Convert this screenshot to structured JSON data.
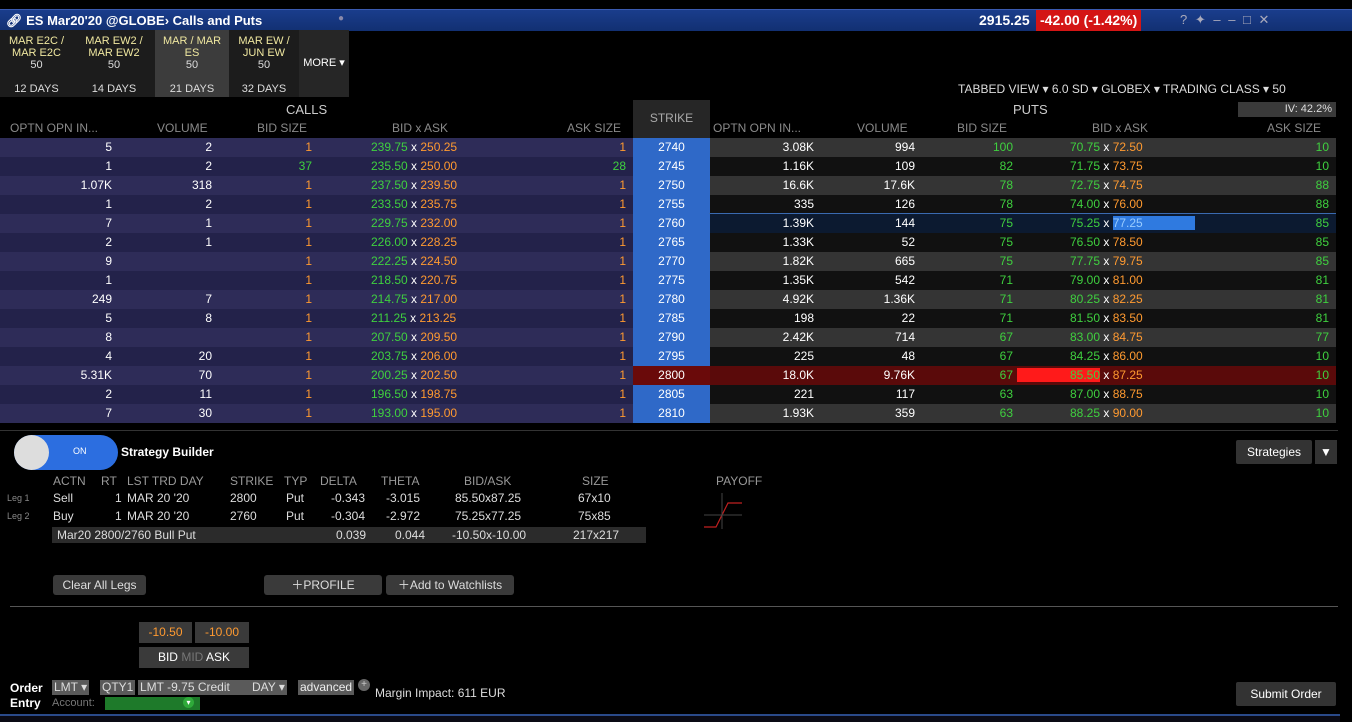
{
  "window": {
    "title": "ES Mar20'20 @GLOBE› Calls and Puts",
    "price": "2915.25",
    "change": "-42.00 (-1.42%)",
    "controls": "? ✦ ‒ – □ ✕"
  },
  "tabs": [
    {
      "l1": "MAR E2C /",
      "l2": "MAR E2C",
      "l3": "50",
      "days": "12 DAYS"
    },
    {
      "l1": "MAR EW2 /",
      "l2": "MAR EW2",
      "l3": "50",
      "days": "14 DAYS"
    },
    {
      "l1": "MAR / MAR",
      "l2": "ES",
      "l3": "50",
      "days": "21 DAYS"
    },
    {
      "l1": "MAR EW /",
      "l2": "JUN EW",
      "l3": "50",
      "days": "32 DAYS"
    }
  ],
  "more": "MORE ▾",
  "view_options": "TABBED VIEW ▾  6.0 SD ▾  GLOBEX ▾  TRADING CLASS ▾  50",
  "calls_label": "CALLS",
  "puts_label": "PUTS",
  "strike_label": "STRIKE",
  "iv": "IV: 42.2%",
  "call_headers": [
    "OPTN OPN IN...",
    "VOLUME",
    "BID SIZE",
    "BID x ASK",
    "ASK SIZE"
  ],
  "put_headers": [
    "OPTN OPN IN...",
    "VOLUME",
    "BID SIZE",
    "BID x ASK",
    "ASK SIZE"
  ],
  "rows": [
    {
      "coi": "5",
      "cvol": "2",
      "cbs": "1",
      "cbid": "239.75",
      "cask": "250.25",
      "cas": "1",
      "strike": "2740",
      "poi": "3.08K",
      "pvol": "994",
      "pbs": "100",
      "pbid": "70.75",
      "pask": "72.50",
      "pas": "10"
    },
    {
      "coi": "1",
      "cvol": "2",
      "cbs": "37",
      "cbid": "235.50",
      "cask": "250.00",
      "cas": "28",
      "strike": "2745",
      "poi": "1.16K",
      "pvol": "109",
      "pbs": "82",
      "pbid": "71.75",
      "pask": "73.75",
      "pas": "10"
    },
    {
      "coi": "1.07K",
      "cvol": "318",
      "cbs": "1",
      "cbid": "237.50",
      "cask": "239.50",
      "cas": "1",
      "strike": "2750",
      "poi": "16.6K",
      "pvol": "17.6K",
      "pbs": "78",
      "pbid": "72.75",
      "pask": "74.75",
      "pas": "88"
    },
    {
      "coi": "1",
      "cvol": "2",
      "cbs": "1",
      "cbid": "233.50",
      "cask": "235.75",
      "cas": "1",
      "strike": "2755",
      "poi": "335",
      "pvol": "126",
      "pbs": "78",
      "pbid": "74.00",
      "pask": "76.00",
      "pas": "88"
    },
    {
      "coi": "7",
      "cvol": "1",
      "cbs": "1",
      "cbid": "229.75",
      "cask": "232.00",
      "cas": "1",
      "strike": "2760",
      "poi": "1.39K",
      "pvol": "144",
      "pbs": "75",
      "pbid": "75.25",
      "pask": "77.25",
      "pas": "85"
    },
    {
      "coi": "2",
      "cvol": "1",
      "cbs": "1",
      "cbid": "226.00",
      "cask": "228.25",
      "cas": "1",
      "strike": "2765",
      "poi": "1.33K",
      "pvol": "52",
      "pbs": "75",
      "pbid": "76.50",
      "pask": "78.50",
      "pas": "85"
    },
    {
      "coi": "9",
      "cvol": "",
      "cbs": "1",
      "cbid": "222.25",
      "cask": "224.50",
      "cas": "1",
      "strike": "2770",
      "poi": "1.82K",
      "pvol": "665",
      "pbs": "75",
      "pbid": "77.75",
      "pask": "79.75",
      "pas": "85"
    },
    {
      "coi": "1",
      "cvol": "",
      "cbs": "1",
      "cbid": "218.50",
      "cask": "220.75",
      "cas": "1",
      "strike": "2775",
      "poi": "1.35K",
      "pvol": "542",
      "pbs": "71",
      "pbid": "79.00",
      "pask": "81.00",
      "pas": "81"
    },
    {
      "coi": "249",
      "cvol": "7",
      "cbs": "1",
      "cbid": "214.75",
      "cask": "217.00",
      "cas": "1",
      "strike": "2780",
      "poi": "4.92K",
      "pvol": "1.36K",
      "pbs": "71",
      "pbid": "80.25",
      "pask": "82.25",
      "pas": "81"
    },
    {
      "coi": "5",
      "cvol": "8",
      "cbs": "1",
      "cbid": "211.25",
      "cask": "213.25",
      "cas": "1",
      "strike": "2785",
      "poi": "198",
      "pvol": "22",
      "pbs": "71",
      "pbid": "81.50",
      "pask": "83.50",
      "pas": "81"
    },
    {
      "coi": "8",
      "cvol": "",
      "cbs": "1",
      "cbid": "207.50",
      "cask": "209.50",
      "cas": "1",
      "strike": "2790",
      "poi": "2.42K",
      "pvol": "714",
      "pbs": "67",
      "pbid": "83.00",
      "pask": "84.75",
      "pas": "77"
    },
    {
      "coi": "4",
      "cvol": "20",
      "cbs": "1",
      "cbid": "203.75",
      "cask": "206.00",
      "cas": "1",
      "strike": "2795",
      "poi": "225",
      "pvol": "48",
      "pbs": "67",
      "pbid": "84.25",
      "pask": "86.00",
      "pas": "10"
    },
    {
      "coi": "5.31K",
      "cvol": "70",
      "cbs": "1",
      "cbid": "200.25",
      "cask": "202.50",
      "cas": "1",
      "strike": "2800",
      "poi": "18.0K",
      "pvol": "9.76K",
      "pbs": "67",
      "pbid": "85.50",
      "pask": "87.25",
      "pas": "10"
    },
    {
      "coi": "2",
      "cvol": "11",
      "cbs": "1",
      "cbid": "196.50",
      "cask": "198.75",
      "cas": "1",
      "strike": "2805",
      "poi": "221",
      "pvol": "117",
      "pbs": "63",
      "pbid": "87.00",
      "pask": "88.75",
      "pas": "10"
    },
    {
      "coi": "7",
      "cvol": "30",
      "cbs": "1",
      "cbid": "193.00",
      "cask": "195.00",
      "cas": "1",
      "strike": "2810",
      "poi": "1.93K",
      "pvol": "359",
      "pbs": "63",
      "pbid": "88.25",
      "pask": "90.00",
      "pas": "10"
    }
  ],
  "strategy": {
    "toggle": "ON",
    "title": "Strategy Builder",
    "strategies_btn": "Strategies",
    "headers": [
      "ACTN",
      "RT",
      "LST TRD DAY",
      "STRIKE",
      "TYP",
      "DELTA",
      "THETA",
      "BID/ASK",
      "SIZE",
      "PAYOFF"
    ],
    "legs": [
      {
        "leg": "Leg 1",
        "actn": "Sell",
        "rt": "1",
        "day": "MAR 20 '20",
        "strike": "2800",
        "typ": "Put",
        "delta": "-0.343",
        "theta": "-3.015",
        "bidask": "85.50x87.25",
        "size": "67x10"
      },
      {
        "leg": "Leg 2",
        "actn": "Buy",
        "rt": "1",
        "day": "MAR 20 '20",
        "strike": "2760",
        "typ": "Put",
        "delta": "-0.304",
        "theta": "-2.972",
        "bidask": "75.25x77.25",
        "size": "75x85"
      }
    ],
    "summary": {
      "name": "Mar20 2800/2760 Bull Put",
      "delta": "0.039",
      "theta": "0.044",
      "bidask": "-10.50x-10.00",
      "size": "217x217"
    },
    "clear": "Clear All Legs",
    "profile": "PROFILE",
    "watch": "Add to Watchlists"
  },
  "order": {
    "price_bid": "-10.50",
    "price_ask": "-10.00",
    "bid": "BID",
    "mid": "MID",
    "ask": "ASK",
    "label1": "Order",
    "label2": "Entry",
    "type": "LMT",
    "qty": "QTY1",
    "lmt": "LMT",
    "price": "-9.75 Credit",
    "tif": "DAY",
    "advanced": "advanced",
    "margin": "Margin Impact: 611 EUR",
    "account": "Account:",
    "submit": "Submit Order"
  },
  "colors": {
    "bid": "#3fd03f",
    "ask": "#ff9a30",
    "strike": "#2f69c8",
    "change": "#d41515"
  }
}
